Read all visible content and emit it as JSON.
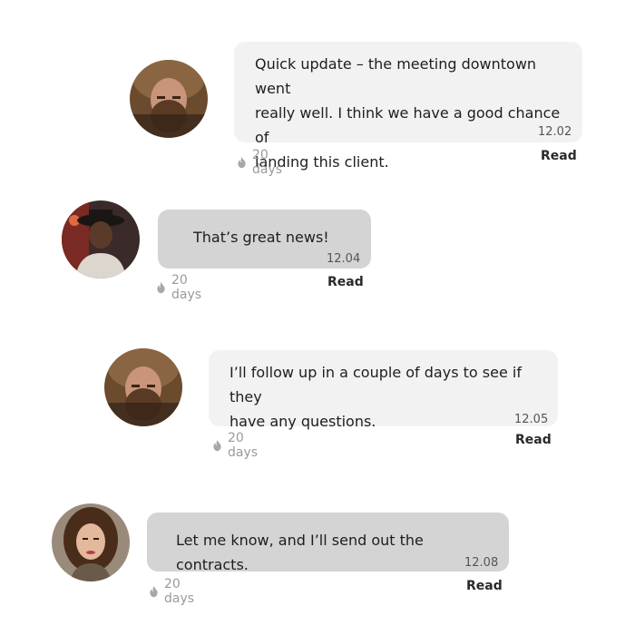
{
  "messages": [
    {
      "sender": "bearded-man",
      "text_lines": [
        "Quick update – the meeting downtown went",
        "really well. I think we have a good chance of",
        "landing this client."
      ],
      "time": "12.02",
      "age": "20 days",
      "status": "Read"
    },
    {
      "sender": "man-in-hat",
      "text_lines": [
        "That’s great news!"
      ],
      "time": "12.04",
      "age": "20 days",
      "status": "Read"
    },
    {
      "sender": "bearded-man",
      "text_lines": [
        "I’ll follow up in a couple of days to see if they",
        "have any questions."
      ],
      "time": "12.05",
      "age": "20 days",
      "status": "Read"
    },
    {
      "sender": "woman",
      "text_lines": [
        "Let me know, and I’ll send out the contracts."
      ],
      "time": "12.08",
      "age": "20 days",
      "status": "Read"
    }
  ],
  "colors": {
    "bubble_light": "#f2f2f2",
    "bubble_dark": "#d4d4d4",
    "meta_text": "#9a9a9a",
    "flame_icon": "#a8a8a8"
  },
  "icons": {
    "age_icon": "flame-icon"
  }
}
